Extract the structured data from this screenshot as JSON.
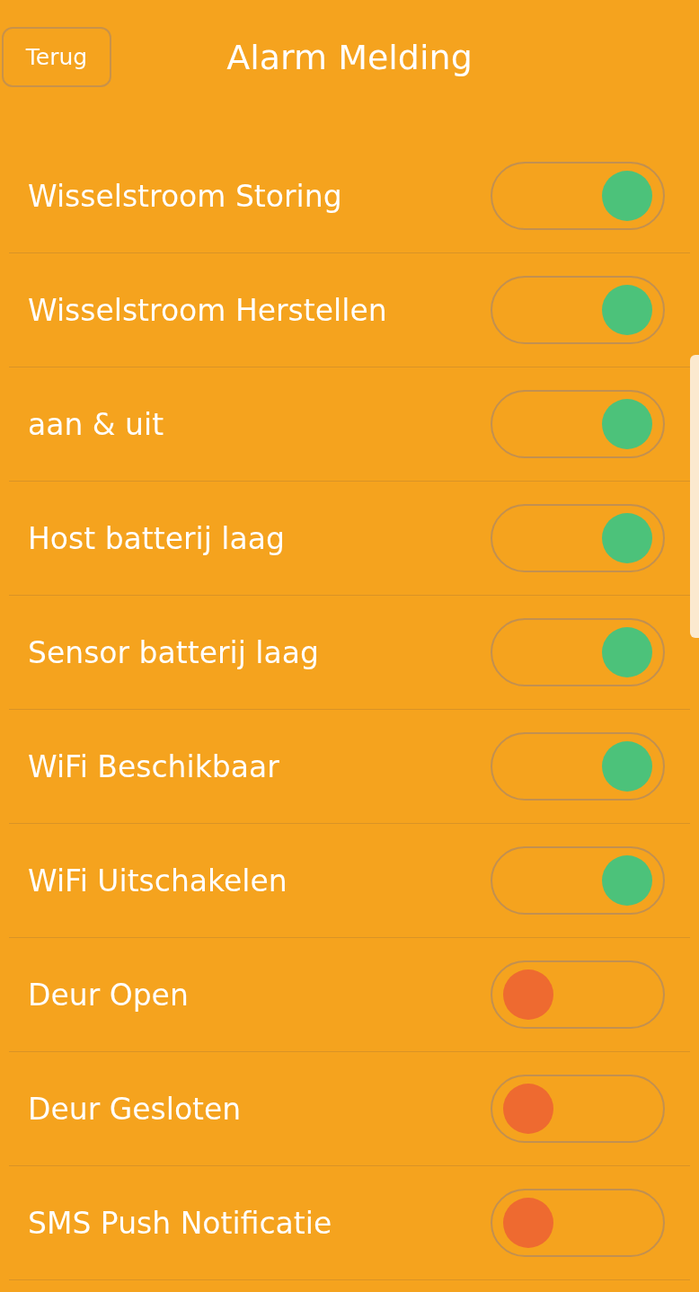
{
  "header": {
    "back_button": "Terug",
    "title": "Alarm Melding"
  },
  "settings": [
    {
      "label": "Wisselstroom Storing",
      "on": true
    },
    {
      "label": "Wisselstroom Herstellen",
      "on": true
    },
    {
      "label": "aan & uit",
      "on": true
    },
    {
      "label": "Host batterij laag",
      "on": true
    },
    {
      "label": "Sensor batterij laag",
      "on": true
    },
    {
      "label": "WiFi Beschikbaar",
      "on": true
    },
    {
      "label": "WiFi Uitschakelen",
      "on": true
    },
    {
      "label": "Deur Open",
      "on": false
    },
    {
      "label": "Deur Gesloten",
      "on": false
    },
    {
      "label": "SMS Push Notificatie",
      "on": false
    }
  ]
}
